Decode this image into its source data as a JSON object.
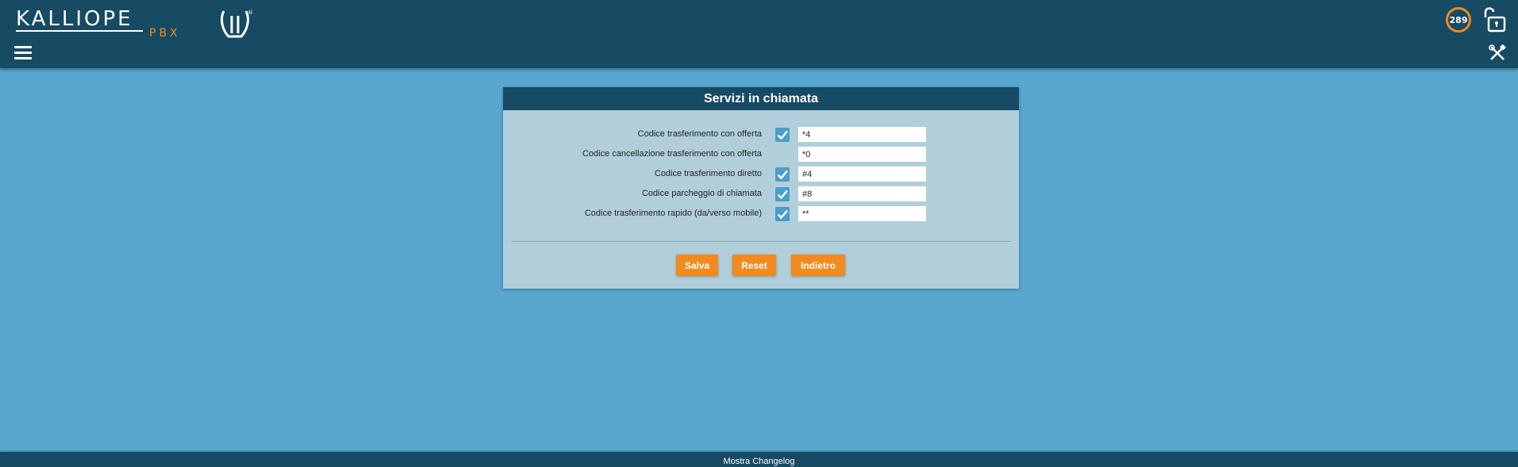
{
  "header": {
    "logo_text": "KALLIOPE",
    "logo_sub": "PBX",
    "counter": "289",
    "icons": {
      "menu": "hamburger-menu-icon",
      "counter": "timer-counter-icon",
      "lock": "unlock-icon",
      "tools": "tools-icon"
    }
  },
  "panel": {
    "title": "Servizi in chiamata",
    "rows": [
      {
        "label": "Codice trasferimento con offerta",
        "checked": true,
        "value": "*4"
      },
      {
        "label": "Codice cancellazione trasferimento con offerta",
        "checked": false,
        "value": "*0"
      },
      {
        "label": "Codice trasferimento diretto",
        "checked": true,
        "value": "#4"
      },
      {
        "label": "Codice parcheggio di chiamata",
        "checked": true,
        "value": "#8"
      },
      {
        "label": "Codice trasferimento rapido (da/verso mobile)",
        "checked": true,
        "value": "**"
      }
    ],
    "buttons": {
      "save": "Salva",
      "reset": "Reset",
      "back": "Indietro"
    }
  },
  "footer": {
    "changelog": "Mostra Changelog"
  },
  "colors": {
    "header_bg": "#174a63",
    "page_bg": "#57a7cf",
    "panel_bg": "#b1cfdb",
    "accent": "#f28a1d",
    "checkbox": "#4a9ec9"
  }
}
